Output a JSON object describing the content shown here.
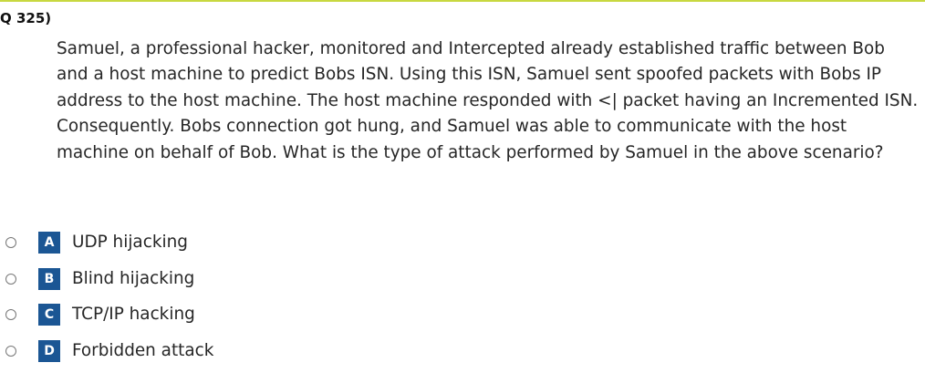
{
  "colors": {
    "top_rule": "#c8d840",
    "badge": "#1b5694"
  },
  "question": {
    "number": "Q 325)",
    "text": "Samuel, a professional hacker, monitored and Intercepted already established traffic between Bob and a host machine to predict Bobs ISN. Using this ISN, Samuel sent spoofed packets with Bobs IP address to the host machine. The host machine responded with <| packet having an Incremented ISN. Consequently. Bobs connection got hung, and Samuel was able to communicate with the host machine on behalf of Bob. What is the type of attack performed by Samuel in the above scenario?"
  },
  "options": [
    {
      "letter": "A",
      "label": "UDP hijacking"
    },
    {
      "letter": "B",
      "label": "Blind hijacking"
    },
    {
      "letter": "C",
      "label": "TCP/IP hacking"
    },
    {
      "letter": "D",
      "label": "Forbidden attack"
    }
  ]
}
